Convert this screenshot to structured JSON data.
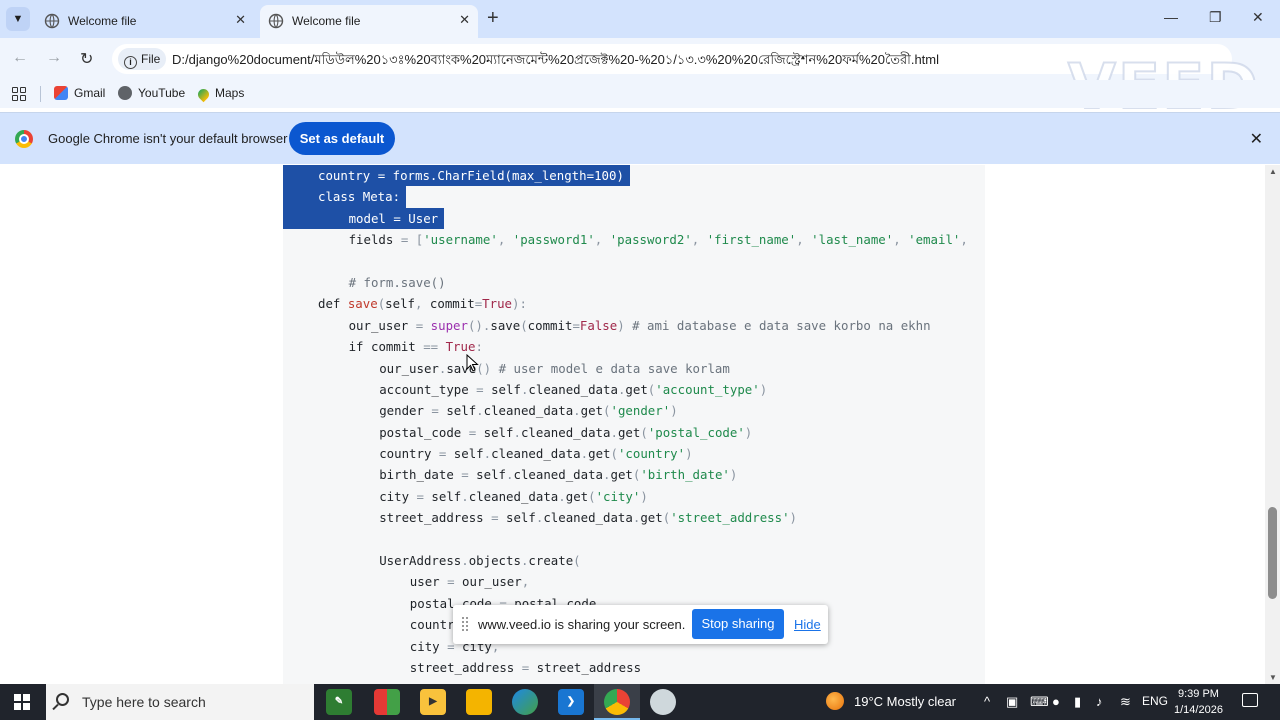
{
  "tabs": [
    {
      "title": "Welcome file",
      "active": false
    },
    {
      "title": "Welcome file",
      "active": true
    }
  ],
  "toolbar": {
    "url_scheme_chip": "File",
    "url": "D:/django%20document/মডিউল%20১৩ঃ%20ব্যাংক%20ম্যানেজমেন্ট%20প্রজেক্ট%20-%20১/১৩.৩%20%20রেজিস্ট্রেশন%20ফর্ম%20তৈরী.html",
    "watermark": "VEED"
  },
  "bookmarks": [
    {
      "label": "Gmail",
      "icon": "gmail-icon"
    },
    {
      "label": "YouTube",
      "icon": "youtube-icon"
    },
    {
      "label": "Maps",
      "icon": "maps-icon"
    }
  ],
  "infobar": {
    "message": "Google Chrome isn't your default browser",
    "button": "Set as default"
  },
  "code_lines": [
    {
      "indent": 0,
      "selected": true,
      "tokens": [
        [
          "kw",
          "country "
        ],
        [
          "op",
          "= "
        ],
        [
          "kw",
          "forms"
        ],
        [
          "op",
          "."
        ],
        [
          "kw",
          "CharField"
        ],
        [
          "op",
          "("
        ],
        [
          "kw",
          "max_length"
        ],
        [
          "op",
          "="
        ],
        [
          "kw",
          "100"
        ],
        [
          "op",
          ")"
        ]
      ]
    },
    {
      "indent": 0,
      "selected": true,
      "tokens": [
        [
          "kw",
          "class Meta"
        ],
        [
          "op",
          ":"
        ]
      ]
    },
    {
      "indent": 1,
      "selected": true,
      "tokens": [
        [
          "kw",
          "model "
        ],
        [
          "op",
          "= "
        ],
        [
          "kw",
          "User"
        ]
      ]
    },
    {
      "indent": 1,
      "selected": false,
      "tokens": [
        [
          "kw",
          "fields "
        ],
        [
          "op",
          "= ["
        ],
        [
          "str",
          "'username'"
        ],
        [
          "op",
          ", "
        ],
        [
          "str",
          "'password1'"
        ],
        [
          "op",
          ", "
        ],
        [
          "str",
          "'password2'"
        ],
        [
          "op",
          ", "
        ],
        [
          "str",
          "'first_name'"
        ],
        [
          "op",
          ", "
        ],
        [
          "str",
          "'last_name'"
        ],
        [
          "op",
          ", "
        ],
        [
          "str",
          "'email'"
        ],
        [
          "op",
          ","
        ]
      ]
    },
    {
      "indent": 0,
      "selected": false,
      "tokens": []
    },
    {
      "indent": 1,
      "selected": false,
      "tokens": [
        [
          "cm",
          "# form.save()"
        ]
      ]
    },
    {
      "indent": 0,
      "selected": false,
      "tokens": [
        [
          "kw",
          "def "
        ],
        [
          "fn",
          "save"
        ],
        [
          "op",
          "("
        ],
        [
          "kw",
          "self"
        ],
        [
          "op",
          ", "
        ],
        [
          "kw",
          "commit"
        ],
        [
          "op",
          "="
        ],
        [
          "bool",
          "True"
        ],
        [
          "op",
          "):"
        ]
      ]
    },
    {
      "indent": 1,
      "selected": false,
      "tokens": [
        [
          "kw",
          "our_user "
        ],
        [
          "op",
          "= "
        ],
        [
          "bi",
          "super"
        ],
        [
          "op",
          "()."
        ],
        [
          "kw",
          "save"
        ],
        [
          "op",
          "("
        ],
        [
          "kw",
          "commit"
        ],
        [
          "op",
          "="
        ],
        [
          "bool",
          "False"
        ],
        [
          "op",
          ") "
        ],
        [
          "cm",
          "# ami database e data save korbo na ekhn"
        ]
      ]
    },
    {
      "indent": 1,
      "selected": false,
      "tokens": [
        [
          "kw",
          "if "
        ],
        [
          "kw",
          "commit "
        ],
        [
          "op",
          "== "
        ],
        [
          "bool",
          "True"
        ],
        [
          "op",
          ":"
        ]
      ]
    },
    {
      "indent": 2,
      "selected": false,
      "tokens": [
        [
          "kw",
          "our_user"
        ],
        [
          "op",
          "."
        ],
        [
          "kw",
          "save"
        ],
        [
          "op",
          "() "
        ],
        [
          "cm",
          "# user model e data save korlam"
        ]
      ]
    },
    {
      "indent": 2,
      "selected": false,
      "tokens": [
        [
          "kw",
          "account_type "
        ],
        [
          "op",
          "= "
        ],
        [
          "kw",
          "self"
        ],
        [
          "op",
          "."
        ],
        [
          "kw",
          "cleaned_data"
        ],
        [
          "op",
          "."
        ],
        [
          "kw",
          "get"
        ],
        [
          "op",
          "("
        ],
        [
          "str",
          "'account_type'"
        ],
        [
          "op",
          ")"
        ]
      ]
    },
    {
      "indent": 2,
      "selected": false,
      "tokens": [
        [
          "kw",
          "gender "
        ],
        [
          "op",
          "= "
        ],
        [
          "kw",
          "self"
        ],
        [
          "op",
          "."
        ],
        [
          "kw",
          "cleaned_data"
        ],
        [
          "op",
          "."
        ],
        [
          "kw",
          "get"
        ],
        [
          "op",
          "("
        ],
        [
          "str",
          "'gender'"
        ],
        [
          "op",
          ")"
        ]
      ]
    },
    {
      "indent": 2,
      "selected": false,
      "tokens": [
        [
          "kw",
          "postal_code "
        ],
        [
          "op",
          "= "
        ],
        [
          "kw",
          "self"
        ],
        [
          "op",
          "."
        ],
        [
          "kw",
          "cleaned_data"
        ],
        [
          "op",
          "."
        ],
        [
          "kw",
          "get"
        ],
        [
          "op",
          "("
        ],
        [
          "str",
          "'postal_code'"
        ],
        [
          "op",
          ")"
        ]
      ]
    },
    {
      "indent": 2,
      "selected": false,
      "tokens": [
        [
          "kw",
          "country "
        ],
        [
          "op",
          "= "
        ],
        [
          "kw",
          "self"
        ],
        [
          "op",
          "."
        ],
        [
          "kw",
          "cleaned_data"
        ],
        [
          "op",
          "."
        ],
        [
          "kw",
          "get"
        ],
        [
          "op",
          "("
        ],
        [
          "str",
          "'country'"
        ],
        [
          "op",
          ")"
        ]
      ]
    },
    {
      "indent": 2,
      "selected": false,
      "tokens": [
        [
          "kw",
          "birth_date "
        ],
        [
          "op",
          "= "
        ],
        [
          "kw",
          "self"
        ],
        [
          "op",
          "."
        ],
        [
          "kw",
          "cleaned_data"
        ],
        [
          "op",
          "."
        ],
        [
          "kw",
          "get"
        ],
        [
          "op",
          "("
        ],
        [
          "str",
          "'birth_date'"
        ],
        [
          "op",
          ")"
        ]
      ]
    },
    {
      "indent": 2,
      "selected": false,
      "tokens": [
        [
          "kw",
          "city "
        ],
        [
          "op",
          "= "
        ],
        [
          "kw",
          "self"
        ],
        [
          "op",
          "."
        ],
        [
          "kw",
          "cleaned_data"
        ],
        [
          "op",
          "."
        ],
        [
          "kw",
          "get"
        ],
        [
          "op",
          "("
        ],
        [
          "str",
          "'city'"
        ],
        [
          "op",
          ")"
        ]
      ]
    },
    {
      "indent": 2,
      "selected": false,
      "tokens": [
        [
          "kw",
          "street_address "
        ],
        [
          "op",
          "= "
        ],
        [
          "kw",
          "self"
        ],
        [
          "op",
          "."
        ],
        [
          "kw",
          "cleaned_data"
        ],
        [
          "op",
          "."
        ],
        [
          "kw",
          "get"
        ],
        [
          "op",
          "("
        ],
        [
          "str",
          "'street_address'"
        ],
        [
          "op",
          ")"
        ]
      ]
    },
    {
      "indent": 0,
      "selected": false,
      "tokens": []
    },
    {
      "indent": 2,
      "selected": false,
      "tokens": [
        [
          "kw",
          "UserAddress"
        ],
        [
          "op",
          "."
        ],
        [
          "kw",
          "objects"
        ],
        [
          "op",
          "."
        ],
        [
          "kw",
          "create"
        ],
        [
          "op",
          "("
        ]
      ]
    },
    {
      "indent": 3,
      "selected": false,
      "tokens": [
        [
          "kw",
          "user "
        ],
        [
          "op",
          "= "
        ],
        [
          "kw",
          "our_user"
        ],
        [
          "op",
          ","
        ]
      ]
    },
    {
      "indent": 3,
      "selected": false,
      "tokens": [
        [
          "kw",
          "postal_code "
        ],
        [
          "op",
          "= "
        ],
        [
          "kw",
          "postal_code"
        ],
        [
          "op",
          ","
        ]
      ]
    },
    {
      "indent": 3,
      "selected": false,
      "tokens": [
        [
          "kw",
          "country "
        ],
        [
          "op",
          "= "
        ],
        [
          "kw",
          "country"
        ],
        [
          "op",
          ","
        ]
      ]
    },
    {
      "indent": 3,
      "selected": false,
      "tokens": [
        [
          "kw",
          "city "
        ],
        [
          "op",
          "= "
        ],
        [
          "kw",
          "city"
        ],
        [
          "op",
          ","
        ]
      ]
    },
    {
      "indent": 3,
      "selected": false,
      "tokens": [
        [
          "kw",
          "street_address "
        ],
        [
          "op",
          "= "
        ],
        [
          "kw",
          "street_address"
        ]
      ]
    }
  ],
  "sharebar": {
    "message": "www.veed.io is sharing your screen.",
    "stop": "Stop sharing",
    "hide": "Hide"
  },
  "taskbar": {
    "search_placeholder": "Type here to search",
    "weather": "19°C  Mostly clear",
    "language": "ENG",
    "time": "9:39 PM",
    "date": "1/14/2026"
  }
}
